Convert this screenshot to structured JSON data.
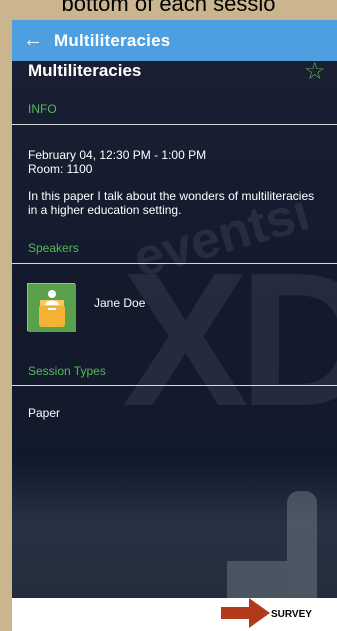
{
  "page_top_text": "bottom of each sessio",
  "app_bar": {
    "title": "Multiliteracies",
    "back_icon": "back-arrow-icon"
  },
  "session": {
    "title": "Multiliteracies",
    "favorite_icon": "star-icon",
    "info_label": "INFO",
    "date_time": "February 04, 12:30 PM - 1:00 PM",
    "room": "Room: 1100",
    "description": "In this paper I talk about the wonders of multiliteracies in a higher education setting."
  },
  "speakers": {
    "label": "Speakers",
    "items": [
      {
        "name": "Jane Doe",
        "avatar_icon": "speaker-avatar-icon"
      }
    ]
  },
  "session_types": {
    "label": "Session Types",
    "items": [
      "Paper"
    ]
  },
  "background": {
    "watermark": "XD",
    "watermark_small": "eventsi"
  },
  "bottom": {
    "survey_label": "SURVEY",
    "arrow_icon": "right-arrow-icon"
  },
  "colors": {
    "app_bar": "#4d9fdf",
    "accent_green": "#57b957",
    "page_background": "#cbb58f",
    "arrow": "#b23a1b"
  }
}
